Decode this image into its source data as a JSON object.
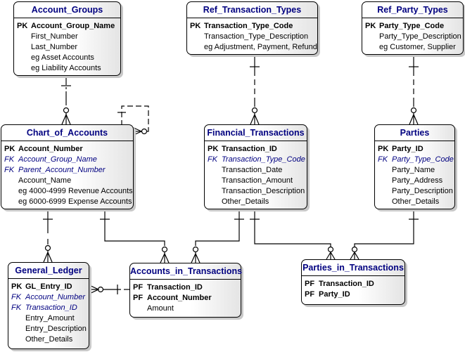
{
  "entities": {
    "account_groups": {
      "title": "Account_Groups",
      "rows": [
        {
          "k": "PK",
          "t": "Account_Group_Name"
        },
        {
          "k": "",
          "t": "First_Number"
        },
        {
          "k": "",
          "t": "Last_Number"
        },
        {
          "k": "",
          "t": "eg Asset Accounts"
        },
        {
          "k": "",
          "t": "eg Liability Accounts"
        }
      ]
    },
    "ref_transaction_types": {
      "title": "Ref_Transaction_Types",
      "rows": [
        {
          "k": "PK",
          "t": "Transaction_Type_Code"
        },
        {
          "k": "",
          "t": "Transaction_Type_Description"
        },
        {
          "k": "",
          "t": "eg Adjustment, Payment, Refund"
        }
      ]
    },
    "ref_party_types": {
      "title": "Ref_Party_Types",
      "rows": [
        {
          "k": "PK",
          "t": "Party_Type_Code"
        },
        {
          "k": "",
          "t": "Party_Type_Description"
        },
        {
          "k": "",
          "t": "eg Customer, Supplier"
        }
      ]
    },
    "chart_of_accounts": {
      "title": "Chart_of_Accounts",
      "rows": [
        {
          "k": "PK",
          "t": "Account_Number"
        },
        {
          "k": "FK",
          "t": "Account_Group_Name"
        },
        {
          "k": "FK",
          "t": "Parent_Account_Number"
        },
        {
          "k": "",
          "t": "Account_Name"
        },
        {
          "k": "",
          "t": "eg 4000-4999 Revenue Accounts"
        },
        {
          "k": "",
          "t": "eg 6000-6999 Expense Accounts"
        }
      ]
    },
    "financial_transactions": {
      "title": "Financial_Transactions",
      "rows": [
        {
          "k": "PK",
          "t": "Transaction_ID"
        },
        {
          "k": "FK",
          "t": "Transaction_Type_Code"
        },
        {
          "k": "",
          "t": "Transaction_Date"
        },
        {
          "k": "",
          "t": "Transaction_Amount"
        },
        {
          "k": "",
          "t": "Transaction_Description"
        },
        {
          "k": "",
          "t": "Other_Details"
        }
      ]
    },
    "parties": {
      "title": "Parties",
      "rows": [
        {
          "k": "PK",
          "t": "Party_ID"
        },
        {
          "k": "FK",
          "t": "Party_Type_Code"
        },
        {
          "k": "",
          "t": "Party_Name"
        },
        {
          "k": "",
          "t": "Party_Address"
        },
        {
          "k": "",
          "t": "Party_Description"
        },
        {
          "k": "",
          "t": "Other_Details"
        }
      ]
    },
    "general_ledger": {
      "title": "General_Ledger",
      "rows": [
        {
          "k": "PK",
          "t": "GL_Entry_ID"
        },
        {
          "k": "FK",
          "t": "Account_Number"
        },
        {
          "k": "FK",
          "t": "Transaction_ID"
        },
        {
          "k": "",
          "t": "Entry_Amount"
        },
        {
          "k": "",
          "t": "Entry_Description"
        },
        {
          "k": "",
          "t": "Other_Details"
        }
      ]
    },
    "accounts_in_transactions": {
      "title": "Accounts_in_Transactions",
      "rows": [
        {
          "k": "PF",
          "t": "Transaction_ID"
        },
        {
          "k": "PF",
          "t": "Account_Number"
        },
        {
          "k": "",
          "t": "Amount"
        }
      ]
    },
    "parties_in_transactions": {
      "title": "Parties_in_Transactions",
      "rows": [
        {
          "k": "PF",
          "t": "Transaction_ID"
        },
        {
          "k": "PF",
          "t": "Party_ID"
        }
      ]
    }
  },
  "colors": {
    "title": "#000080",
    "line": "#000000"
  }
}
